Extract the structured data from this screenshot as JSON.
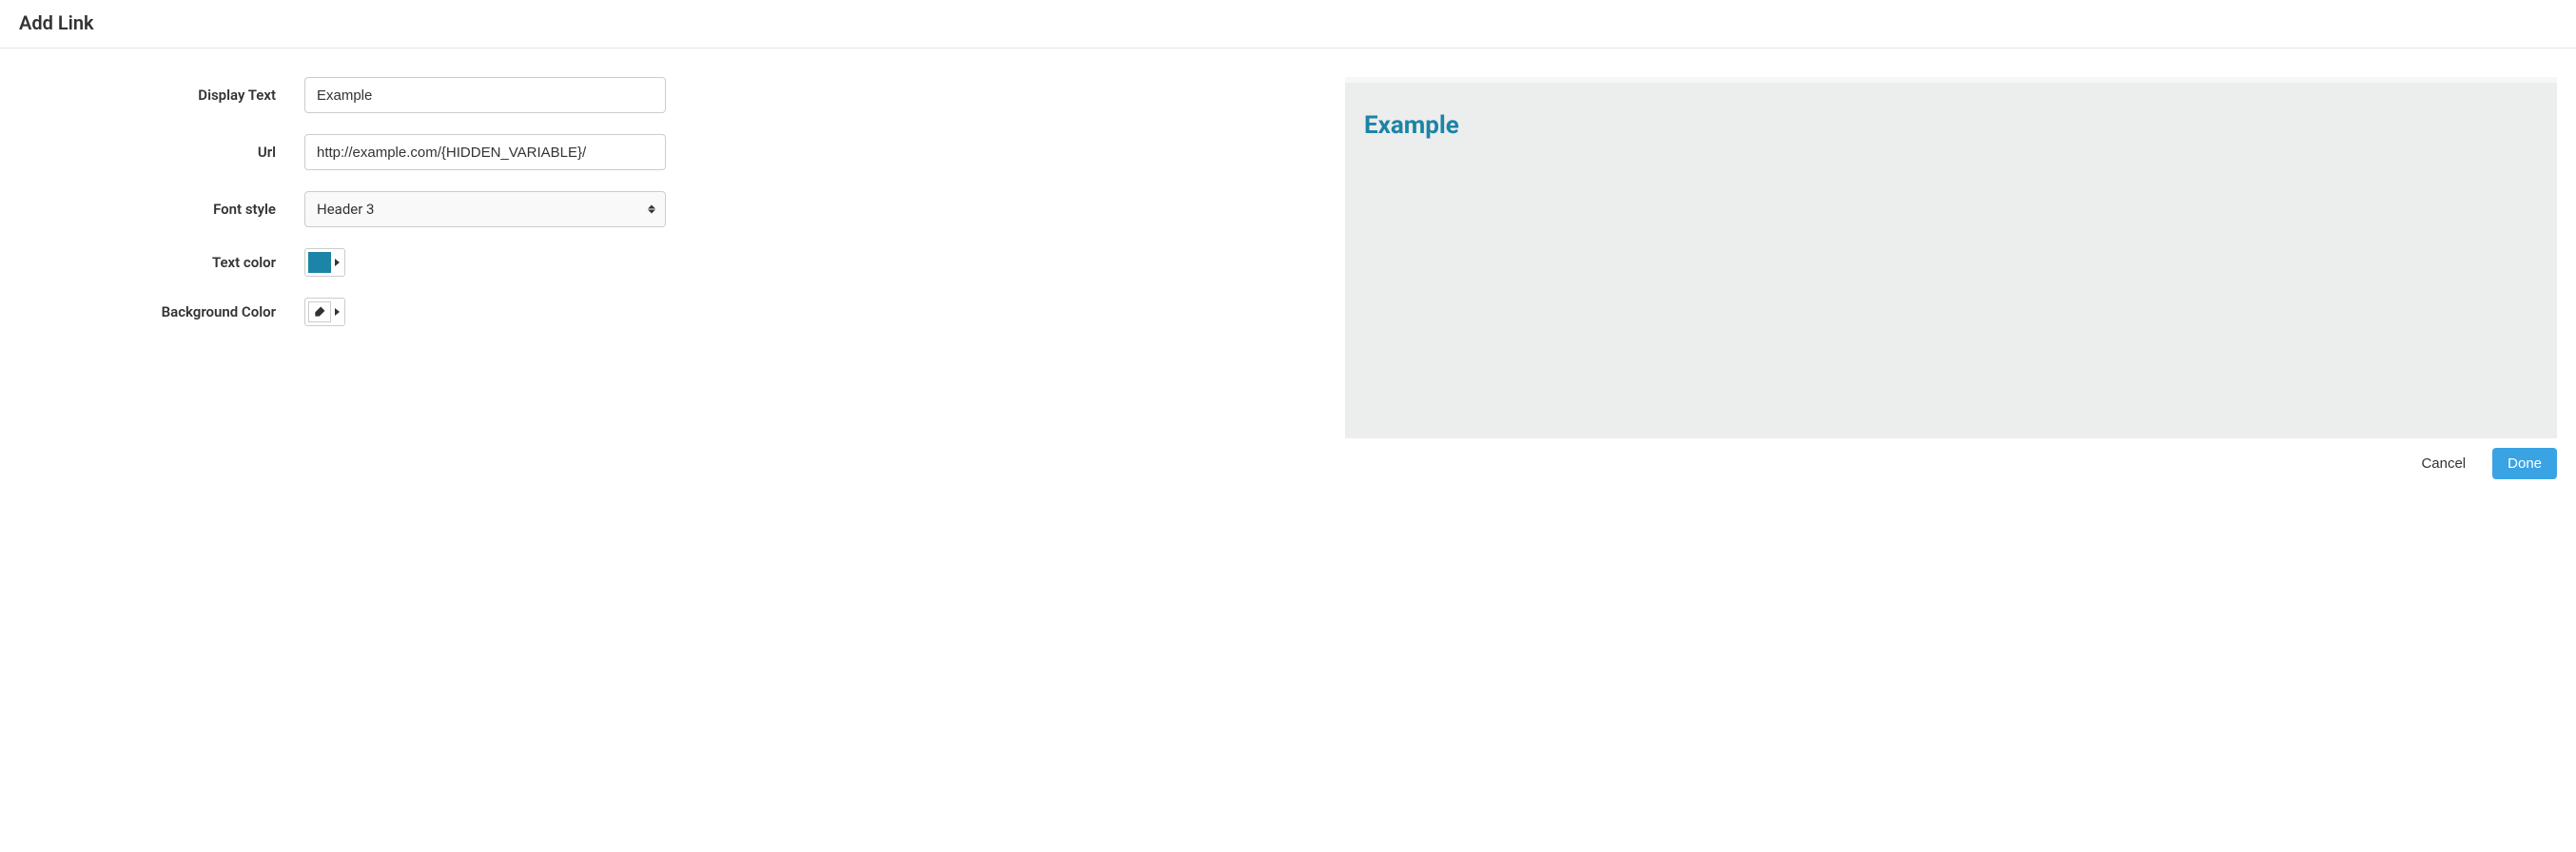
{
  "dialog": {
    "title": "Add Link"
  },
  "form": {
    "display_text": {
      "label": "Display Text",
      "value": "Example"
    },
    "url": {
      "label": "Url",
      "value": "http://example.com/{HIDDEN_VARIABLE}/"
    },
    "font_style": {
      "label": "Font style",
      "value": "Header 3"
    },
    "text_color": {
      "label": "Text color",
      "value": "#1c84a6"
    },
    "bg_color": {
      "label": "Background Color",
      "icon": "brush-icon"
    }
  },
  "preview": {
    "text": "Example",
    "text_color": "#1c84a6"
  },
  "footer": {
    "cancel": "Cancel",
    "done": "Done"
  }
}
